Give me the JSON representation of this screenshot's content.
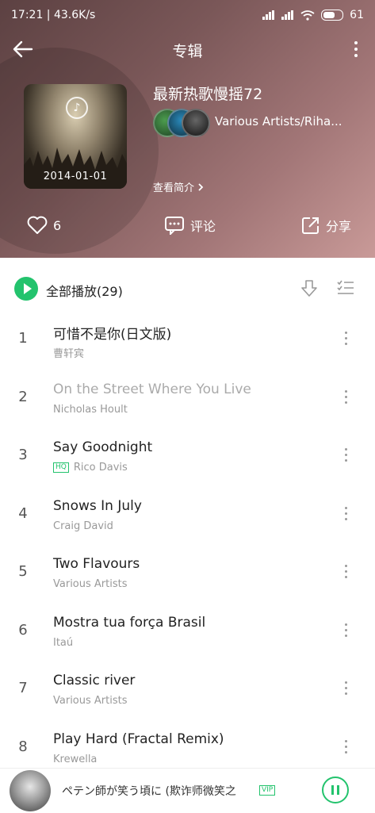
{
  "status_bar": {
    "left_text": "17:21 | 43.6K/s",
    "battery_label": "61"
  },
  "header": {
    "title": "专辑",
    "album_name": "最新热歌慢摇72",
    "artist": "Various Artists/Riha...",
    "release_date": "2014-01-01",
    "intro_link": "查看简介",
    "likes": "6",
    "comment_label": "评论",
    "share_label": "分享"
  },
  "play_all": {
    "label": "全部播放(29)"
  },
  "tracks": [
    {
      "num": "1",
      "name": "可惜不是你(日文版)",
      "artist": "曹轩宾"
    },
    {
      "num": "2",
      "name": "On the Street Where You Live",
      "artist": "Nicholas Hoult"
    },
    {
      "num": "3",
      "name": "Say Goodnight",
      "artist": "Rico Davis",
      "badge": "HQ"
    },
    {
      "num": "4",
      "name": "Snows In July",
      "artist": "Craig David"
    },
    {
      "num": "5",
      "name": "Two Flavours",
      "artist": "Various Artists"
    },
    {
      "num": "6",
      "name": "Mostra tua força Brasil",
      "artist": "Itaú"
    },
    {
      "num": "7",
      "name": "Classic river",
      "artist": "Various Artists"
    },
    {
      "num": "8",
      "name": "Play Hard (Fractal Remix)",
      "artist": "Krewella"
    }
  ],
  "player": {
    "song": "ペテン師が笑う頃に (欺诈师微笑之",
    "badge": "VIP"
  },
  "colors": {
    "accent": "#23c36d",
    "header_dark": "#5c4142",
    "header_light": "#c99a98"
  }
}
